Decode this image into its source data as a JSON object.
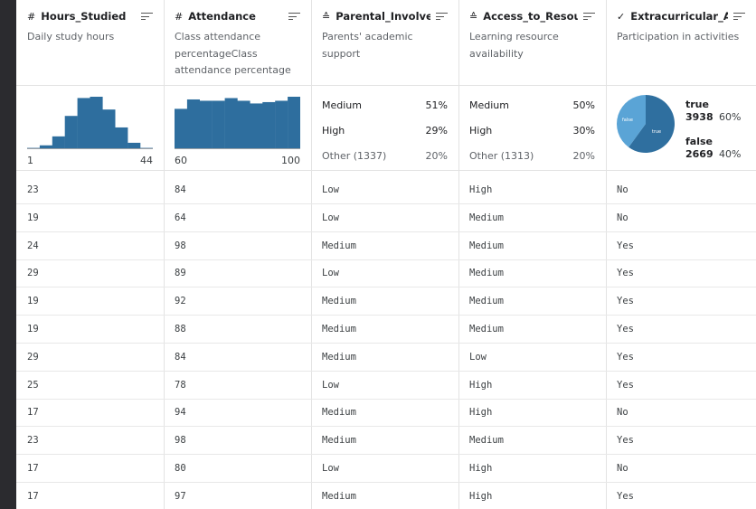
{
  "columns": [
    {
      "type": "#",
      "name": "Hours_Studied",
      "desc": "Daily study hours",
      "summary": {
        "kind": "histogram",
        "min": "1",
        "max": "44",
        "bins": [
          1,
          3,
          10,
          26,
          40,
          41,
          31,
          17,
          5,
          1
        ]
      },
      "cells": [
        "23",
        "19",
        "24",
        "29",
        "19",
        "19",
        "29",
        "25",
        "17",
        "23",
        "17",
        "17"
      ]
    },
    {
      "type": "#",
      "name": "Attendance",
      "desc": "Class attendance percentageClass attendance percentage",
      "summary": {
        "kind": "histogram",
        "min": "60",
        "max": "100",
        "bins": [
          30,
          37,
          36,
          36,
          38,
          36,
          34,
          35,
          36,
          39
        ]
      },
      "cells": [
        "84",
        "64",
        "98",
        "89",
        "92",
        "88",
        "84",
        "78",
        "94",
        "98",
        "80",
        "97"
      ]
    },
    {
      "type": "≙",
      "name": "Parental_Involve...",
      "desc": "Parents' academic support",
      "summary": {
        "kind": "categories",
        "rows": [
          {
            "label": "Medium",
            "pct": "51%"
          },
          {
            "label": "High",
            "pct": "29%"
          },
          {
            "label": "Other (1337)",
            "pct": "20%"
          }
        ]
      },
      "cells": [
        "Low",
        "Low",
        "Medium",
        "Low",
        "Medium",
        "Medium",
        "Medium",
        "Low",
        "Medium",
        "Medium",
        "Low",
        "Medium"
      ]
    },
    {
      "type": "≙",
      "name": "Access_to_Resou...",
      "desc": "Learning resource availability",
      "summary": {
        "kind": "categories",
        "rows": [
          {
            "label": "Medium",
            "pct": "50%"
          },
          {
            "label": "High",
            "pct": "30%"
          },
          {
            "label": "Other (1313)",
            "pct": "20%"
          }
        ]
      },
      "cells": [
        "High",
        "Medium",
        "Medium",
        "Medium",
        "Medium",
        "Medium",
        "Low",
        "High",
        "High",
        "Medium",
        "High",
        "High"
      ]
    },
    {
      "type": "✓",
      "name": "Extracurricular_A...",
      "desc": "Participation in activities",
      "summary": {
        "kind": "boolean",
        "true_label": "true",
        "true_count": "3938",
        "true_pct": "60%",
        "false_label": "false",
        "false_count": "2669",
        "false_pct": "40%",
        "pie_true_label": "true",
        "pie_false_label": "false",
        "true_fraction": 0.6,
        "colors": {
          "true": "#2f6f9f",
          "false": "#5aa4d6"
        }
      },
      "cells": [
        "No",
        "No",
        "Yes",
        "Yes",
        "Yes",
        "Yes",
        "Yes",
        "Yes",
        "No",
        "Yes",
        "No",
        "Yes"
      ]
    }
  ],
  "colors": {
    "bar": "#2e6e9e",
    "background": "#2b2b2f"
  }
}
